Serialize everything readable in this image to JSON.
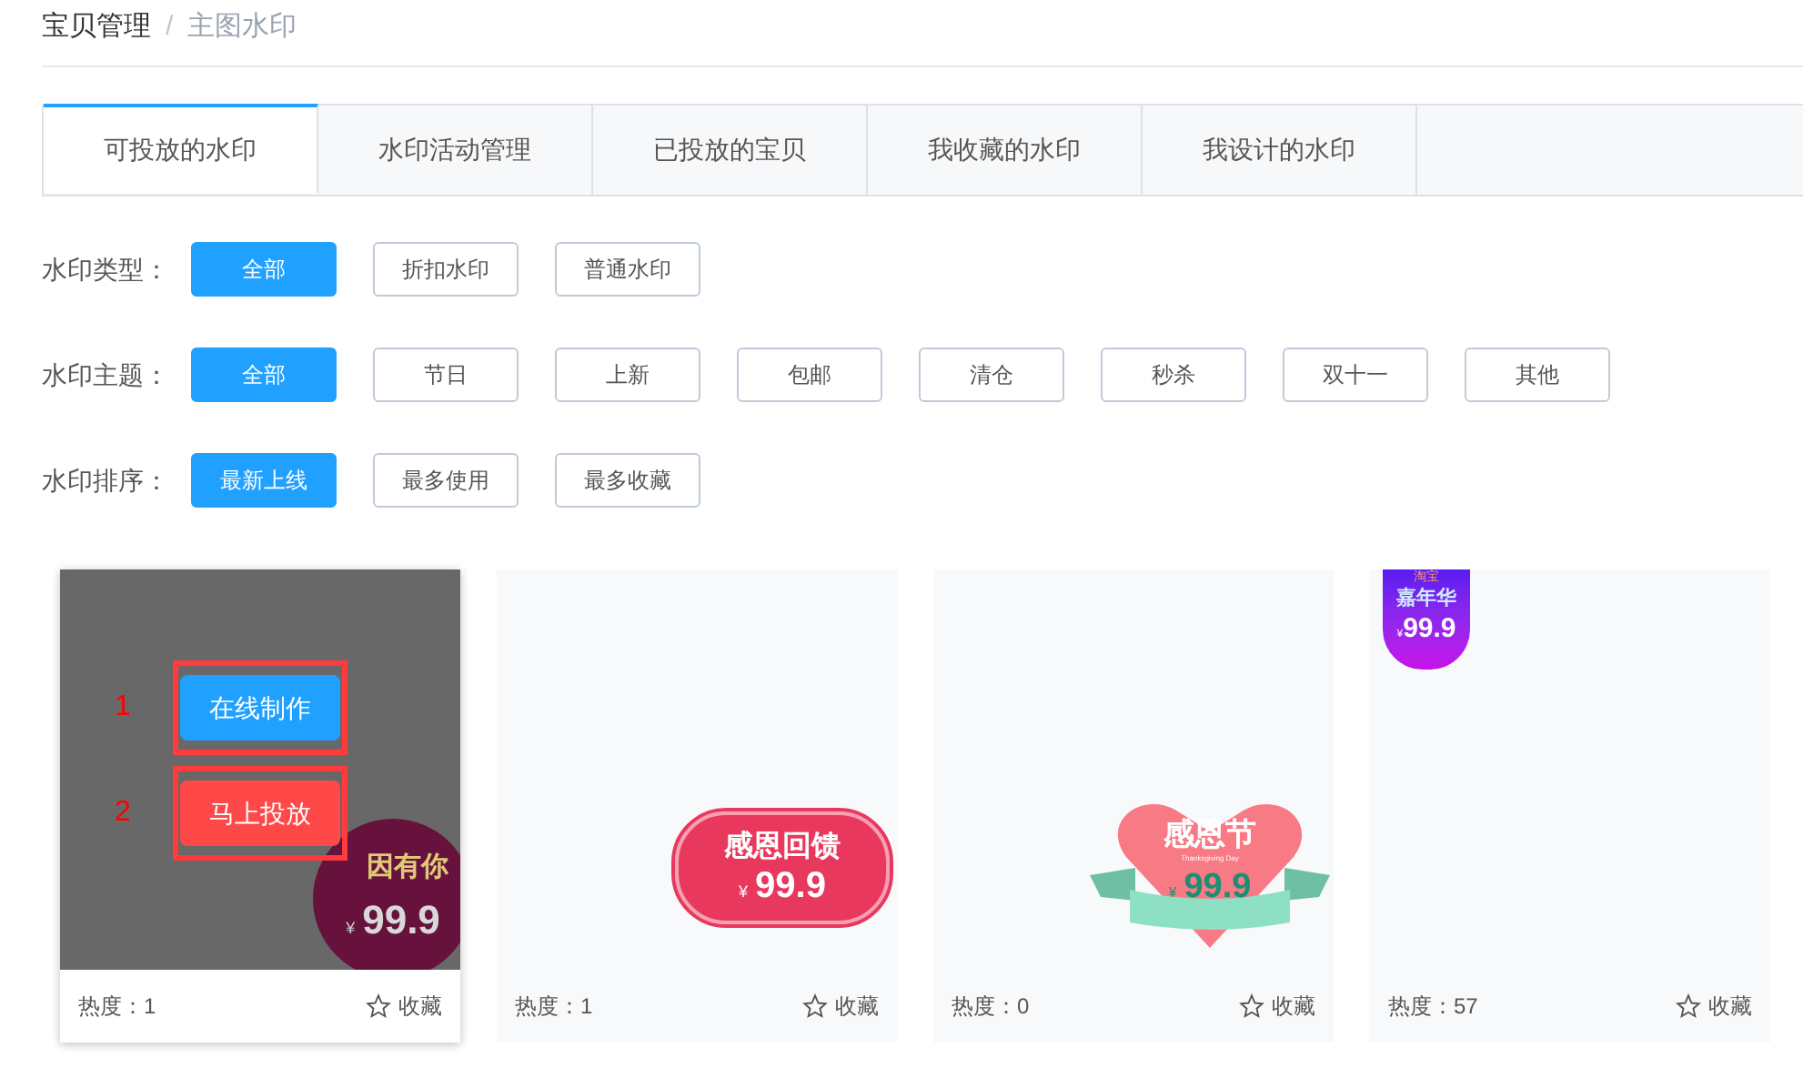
{
  "breadcrumb": [
    "宝贝管理",
    "主图水印"
  ],
  "breadcrumb_separator": "/",
  "tabs": [
    {
      "label": "可投放的水印",
      "selected": true
    },
    {
      "label": "水印活动管理",
      "selected": false
    },
    {
      "label": "已投放的宝贝",
      "selected": false
    },
    {
      "label": "我收藏的水印",
      "selected": false
    },
    {
      "label": "我设计的水印",
      "selected": false
    }
  ],
  "filters": [
    {
      "label": "水印类型：",
      "options": [
        {
          "label": "全部",
          "selected": true
        },
        {
          "label": "折扣水印",
          "selected": false
        },
        {
          "label": "普通水印",
          "selected": false
        }
      ]
    },
    {
      "label": "水印主题：",
      "options": [
        {
          "label": "全部",
          "selected": true
        },
        {
          "label": "节日",
          "selected": false
        },
        {
          "label": "上新",
          "selected": false
        },
        {
          "label": "包邮",
          "selected": false
        },
        {
          "label": "清仓",
          "selected": false
        },
        {
          "label": "秒杀",
          "selected": false
        },
        {
          "label": "双十一",
          "selected": false
        },
        {
          "label": "其他",
          "selected": false
        }
      ]
    },
    {
      "label": "水印排序：",
      "options": [
        {
          "label": "最新上线",
          "selected": true
        },
        {
          "label": "最多使用",
          "selected": false
        },
        {
          "label": "最多收藏",
          "selected": false
        }
      ]
    }
  ],
  "cards": [
    {
      "hovered": true,
      "badge": {
        "kind": "circle",
        "title": "因有你",
        "currency": "¥",
        "price": "99.9"
      },
      "actions": [
        {
          "kind": "primary",
          "label": "在线制作",
          "annotation": "1"
        },
        {
          "kind": "danger",
          "label": "马上投放",
          "annotation": "2"
        }
      ],
      "heat": "热度：1",
      "favorite": "收藏"
    },
    {
      "hovered": false,
      "badge": {
        "kind": "scallop",
        "title": "感恩回馈",
        "currency": "¥",
        "price": "99.9"
      },
      "heat": "热度：1",
      "favorite": "收藏"
    },
    {
      "hovered": false,
      "badge": {
        "kind": "heart",
        "title": "感恩节",
        "subtitle": "Thanksgiving Day",
        "currency": "¥",
        "price": "99.9"
      },
      "heat": "热度：0",
      "favorite": "收藏"
    },
    {
      "hovered": false,
      "badge": {
        "kind": "tag",
        "subtitle": "淘宝",
        "title": "嘉年华",
        "currency": "¥",
        "price": "99.9"
      },
      "heat": "热度：57",
      "favorite": "收藏"
    }
  ]
}
